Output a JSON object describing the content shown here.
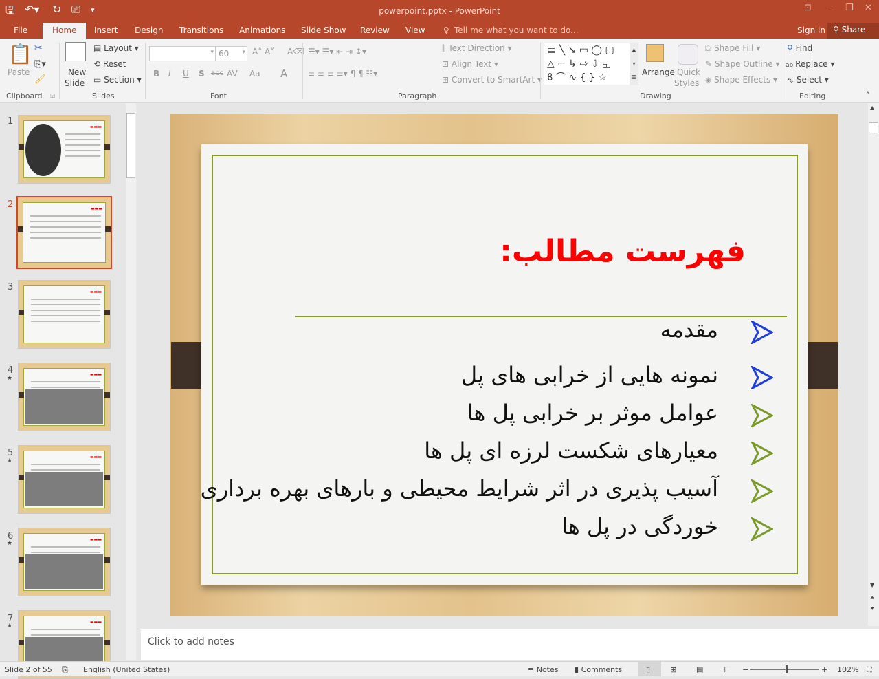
{
  "window": {
    "title": "powerpoint.pptx - PowerPoint",
    "controls": [
      "restore-ribbon",
      "minimize",
      "maximize",
      "close"
    ]
  },
  "tabs": [
    {
      "label": "File"
    },
    {
      "label": "Home",
      "active": true
    },
    {
      "label": "Insert"
    },
    {
      "label": "Design"
    },
    {
      "label": "Transitions"
    },
    {
      "label": "Animations"
    },
    {
      "label": "Slide Show"
    },
    {
      "label": "Review"
    },
    {
      "label": "View"
    }
  ],
  "tell_me": "Tell me what you want to do...",
  "sign_in": "Sign in",
  "share": "Share",
  "ribbon": {
    "clipboard": {
      "paste": "Paste",
      "group": "Clipboard"
    },
    "slides": {
      "new_slide_1": "New",
      "new_slide_2": "Slide",
      "layout": "Layout",
      "reset": "Reset",
      "section": "Section",
      "group": "Slides"
    },
    "font": {
      "font_name": "",
      "font_size": "60",
      "bold": "B",
      "italic": "I",
      "underline": "U",
      "shadow": "S",
      "strike": "abc",
      "spacing": "AV",
      "case": "Aa",
      "color": "A",
      "group": "Font"
    },
    "paragraph": {
      "text_direction": "Text Direction",
      "align_text": "Align Text",
      "convert_smartart": "Convert to SmartArt",
      "group": "Paragraph"
    },
    "drawing": {
      "arrange": "Arrange",
      "quick_styles_1": "Quick",
      "quick_styles_2": "Styles",
      "shape_fill": "Shape Fill",
      "shape_outline": "Shape Outline",
      "shape_effects": "Shape Effects",
      "group": "Drawing"
    },
    "editing": {
      "find": "Find",
      "replace": "Replace",
      "select": "Select",
      "group": "Editing"
    }
  },
  "thumbnails": [
    {
      "num": "1",
      "star": ""
    },
    {
      "num": "2",
      "star": "",
      "selected": true
    },
    {
      "num": "3",
      "star": ""
    },
    {
      "num": "4",
      "star": "★"
    },
    {
      "num": "5",
      "star": "★"
    },
    {
      "num": "6",
      "star": "★"
    },
    {
      "num": "7",
      "star": "★"
    }
  ],
  "slide": {
    "title": "فهرست مطالب:",
    "items": [
      {
        "text": "مقدمه",
        "bullet_color": "#1f3fd6"
      },
      {
        "text": "نمونه هایی از خرابی های پل",
        "bullet_color": "#1f3fd6"
      },
      {
        "text": "عوامل موثر بر خرابی پل ها",
        "bullet_color": "#7a9a2a"
      },
      {
        "text": "معیارهای شکست لرزه ای پل ها",
        "bullet_color": "#7a9a2a"
      },
      {
        "text": "آسیب پذیری در اثر شرایط محیطی و بارهای بهره برداری",
        "bullet_color": "#7a9a2a"
      },
      {
        "text": "خوردگی در پل ها",
        "bullet_color": "#7a9a2a"
      }
    ],
    "title_color": "#ff0000"
  },
  "notes_placeholder": "Click to add notes",
  "status": {
    "slide": "Slide 2 of 55",
    "language": "English (United States)",
    "notes": "Notes",
    "comments": "Comments",
    "zoom": "102%",
    "zoom_value": 102
  },
  "colors": {
    "accent": "#b7472a"
  }
}
